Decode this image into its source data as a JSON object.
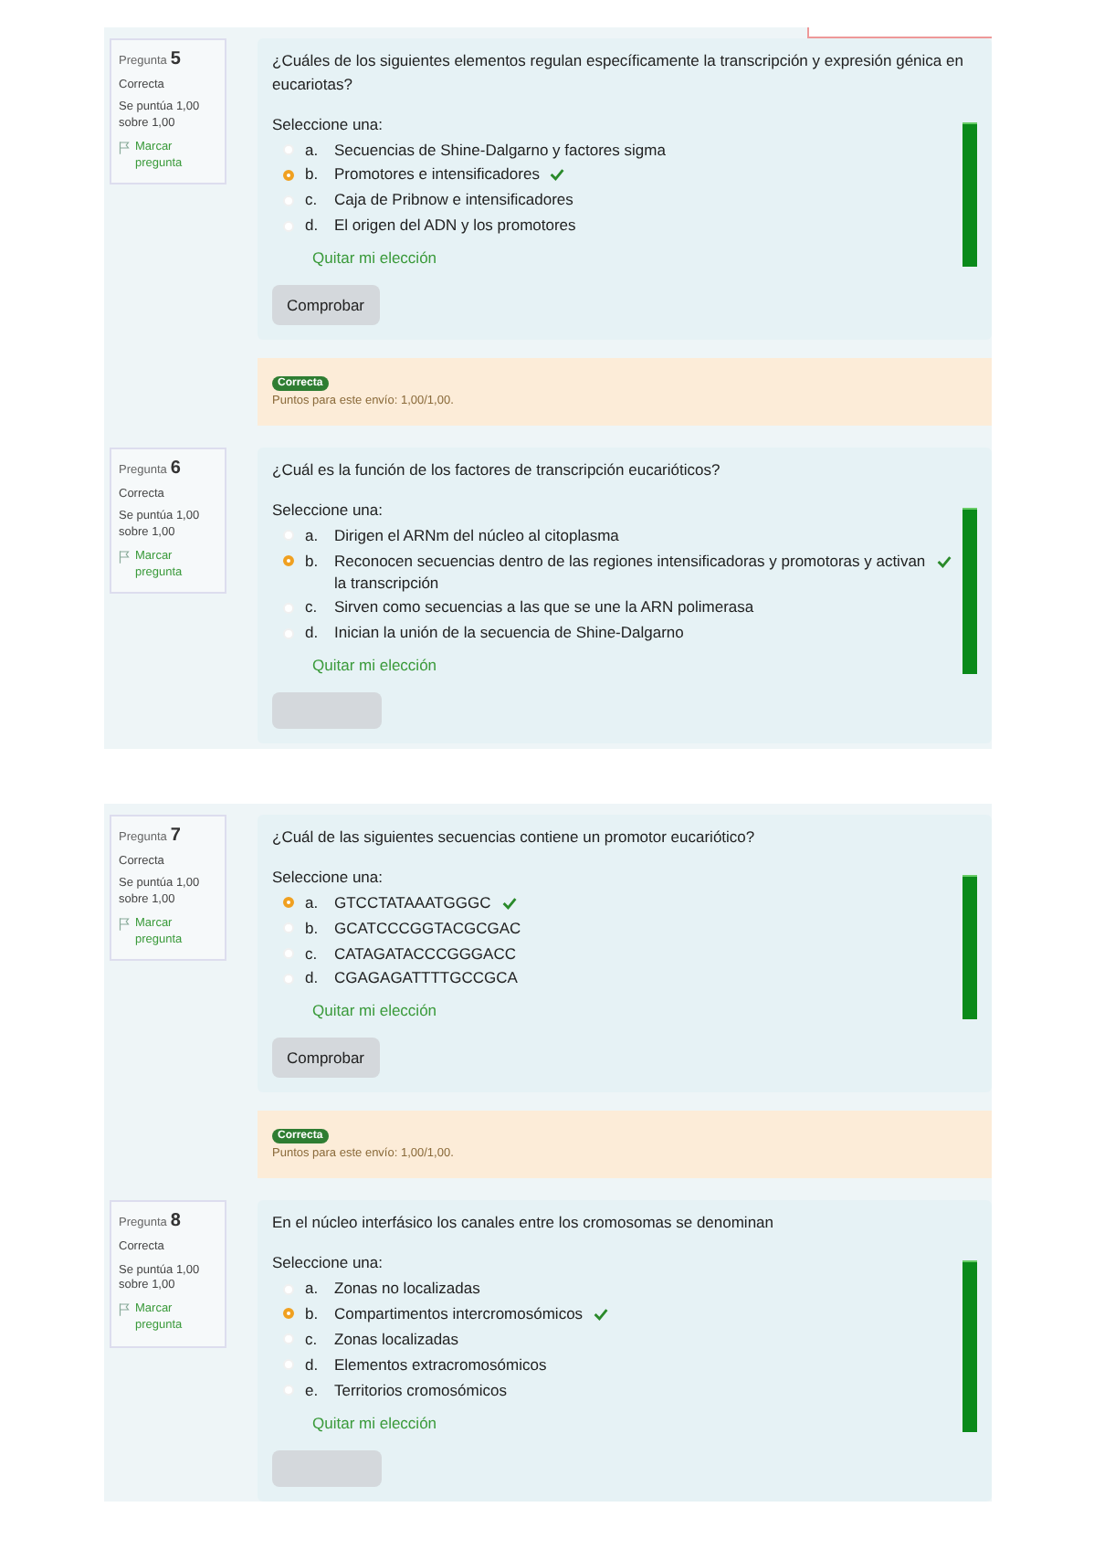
{
  "panels": [
    {
      "questions": [
        {
          "label": "Pregunta",
          "number": "5",
          "status": "Correcta",
          "score": "Se puntúa 1,00 sobre 1,00",
          "flag": "Marcar pregunta",
          "text": "¿Cuáles de los siguientes elementos regulan específicamente la transcripción y expresión génica en eucariotas?",
          "prompt": "Seleccione una:",
          "options": [
            {
              "letter": "a.",
              "text": "Secuencias de Shine-Dalgarno y factores sigma",
              "selected": false,
              "correct": false
            },
            {
              "letter": "b.",
              "text": "Promotores e intensificadores",
              "selected": true,
              "correct": true
            },
            {
              "letter": "c.",
              "text": "Caja de Pribnow e intensificadores",
              "selected": false,
              "correct": false
            },
            {
              "letter": "d.",
              "text": "El origen del ADN y los promotores",
              "selected": false,
              "correct": false
            }
          ],
          "clear": "Quitar mi elección",
          "button": {
            "kind": "full",
            "label": "Comprobar"
          },
          "feedback": {
            "badge": "Correcta",
            "text": "Puntos para este envío: 1,00/1,00."
          }
        },
        {
          "label": "Pregunta",
          "number": "6",
          "status": "Correcta",
          "score": "Se puntúa 1,00 sobre 1,00",
          "flag": "Marcar pregunta",
          "text": "¿Cuál es la función de los factores de transcripción eucarióticos?",
          "prompt": "Seleccione una:",
          "options": [
            {
              "letter": "a.",
              "text": "Dirigen el ARNm del núcleo al citoplasma",
              "selected": false,
              "correct": false
            },
            {
              "letter": "b.",
              "text": "Reconocen secuencias dentro de las regiones intensificadoras y promotoras y activan la transcripción",
              "selected": true,
              "correct": true
            },
            {
              "letter": "c.",
              "text": "Sirven como secuencias a las que se une la ARN polimerasa",
              "selected": false,
              "correct": false
            },
            {
              "letter": "d.",
              "text": "Inician la unión de la secuencia de Shine-Dalgarno",
              "selected": false,
              "correct": false
            }
          ],
          "clear": "Quitar mi elección",
          "button": {
            "kind": "cut"
          }
        }
      ]
    },
    {
      "questions": [
        {
          "label": "Pregunta",
          "number": "7",
          "status": "Correcta",
          "score": "Se puntúa 1,00 sobre 1,00",
          "flag": "Marcar pregunta",
          "text": "¿Cuál de las siguientes secuencias contiene un promotor eucariótico?",
          "prompt": "Seleccione una:",
          "options": [
            {
              "letter": "a.",
              "text": "GTCCTATAAATGGGC",
              "selected": true,
              "correct": true
            },
            {
              "letter": "b.",
              "text": "GCATCCCGGTACGCGAC",
              "selected": false,
              "correct": false
            },
            {
              "letter": "c.",
              "text": "CATAGATACCCGGGACC",
              "selected": false,
              "correct": false
            },
            {
              "letter": "d.",
              "text": "CGAGAGATTTTGCCGCA",
              "selected": false,
              "correct": false
            }
          ],
          "clear": "Quitar mi elección",
          "button": {
            "kind": "full",
            "label": "Comprobar"
          },
          "feedback": {
            "badge": "Correcta",
            "text": "Puntos para este envío: 1,00/1,00."
          }
        },
        {
          "label": "Pregunta",
          "number": "8",
          "status": "Correcta",
          "score": "Se puntúa 1,00 sobre 1,00",
          "flag": "Marcar pregunta",
          "text": "En el núcleo interfásico los canales entre los cromosomas se denominan",
          "prompt": "Seleccione una:",
          "options": [
            {
              "letter": "a.",
              "text": "Zonas no localizadas",
              "selected": false,
              "correct": false
            },
            {
              "letter": "b.",
              "text": "Compartimentos intercromosómicos",
              "selected": true,
              "correct": true
            },
            {
              "letter": "c.",
              "text": "Zonas localizadas",
              "selected": false,
              "correct": false
            },
            {
              "letter": "d.",
              "text": "Elementos extracromosómicos",
              "selected": false,
              "correct": false
            },
            {
              "letter": "e.",
              "text": "Territorios cromosómicos",
              "selected": false,
              "correct": false
            }
          ],
          "clear": "Quitar mi elección",
          "button": {
            "kind": "cut"
          }
        }
      ]
    }
  ]
}
